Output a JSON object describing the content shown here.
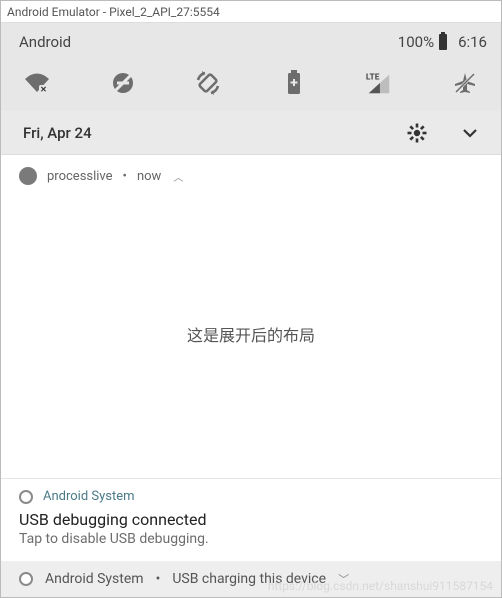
{
  "window": {
    "title": "Android Emulator - Pixel_2_API_27:5554"
  },
  "status": {
    "title": "Android",
    "battery_pct": "100%",
    "clock": "6:16"
  },
  "quick_settings": {
    "icons": [
      "wifi-off",
      "dnd-off",
      "auto-rotate",
      "battery",
      "lte-signal",
      "airplane-off"
    ]
  },
  "date_row": {
    "date": "Fri, Apr 24"
  },
  "notif_expanded": {
    "app": "processlive",
    "time": "now",
    "body": "这是展开后的布局"
  },
  "notif_usb": {
    "source": "Android System",
    "title": "USB debugging connected",
    "subtitle": "Tap to disable USB debugging."
  },
  "notif_collapsed": {
    "source": "Android System",
    "summary": "USB charging this device"
  },
  "watermark": "https://blog.csdn.net/shanshui911587154"
}
